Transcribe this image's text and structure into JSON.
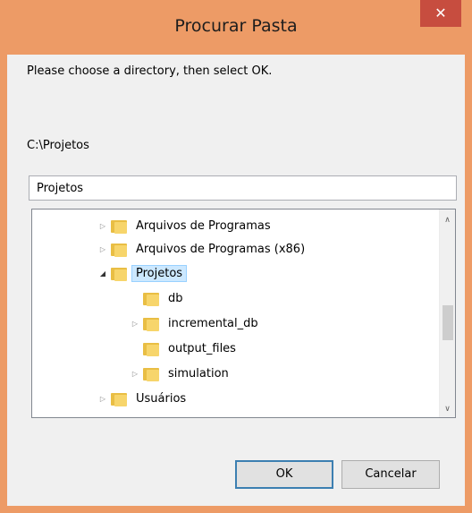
{
  "window": {
    "title": "Procurar Pasta",
    "close_label": "✕"
  },
  "dialog": {
    "message": "Please choose a directory, then select OK.",
    "current_path": "C:\\Projetos",
    "folder_name_value": "Projetos"
  },
  "tree": {
    "items": [
      {
        "label": "Arquivos de Programas",
        "expanded": false,
        "selected": false
      },
      {
        "label": "Arquivos de Programas (x86)",
        "expanded": false,
        "selected": false
      },
      {
        "label": "Projetos",
        "expanded": true,
        "selected": true
      },
      {
        "label": "db",
        "expanded": false,
        "selected": false
      },
      {
        "label": "incremental_db",
        "expanded": false,
        "selected": false
      },
      {
        "label": "output_files",
        "expanded": false,
        "selected": false
      },
      {
        "label": "simulation",
        "expanded": false,
        "selected": false
      },
      {
        "label": "Usuários",
        "expanded": false,
        "selected": false
      }
    ]
  },
  "buttons": {
    "ok_label": "OK",
    "cancel_label": "Cancelar"
  },
  "icons": {
    "expand": "▷",
    "collapse": "◢",
    "scroll_up": "∧",
    "scroll_down": "∨"
  },
  "colors": {
    "title_bar": "#ED9B66",
    "close_button": "#C74D3F",
    "selection_bg": "#CCE8FF",
    "folder": "#F7D56B"
  }
}
